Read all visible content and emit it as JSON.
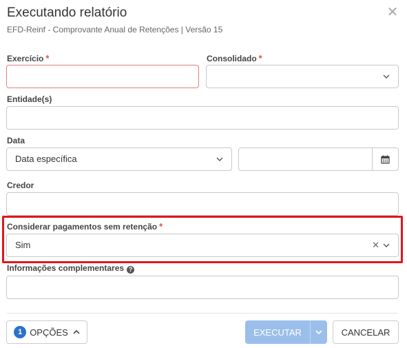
{
  "dialog": {
    "title": "Executando relatório",
    "subtitle": "EFD-Reinf - Comprovante Anual de Retenções | Versão 15",
    "close_glyph": "✕"
  },
  "fields": {
    "exercicio": {
      "label": "Exercício",
      "required_mark": "*",
      "value": ""
    },
    "consolidado": {
      "label": "Consolidado",
      "required_mark": "*",
      "value": ""
    },
    "entidades": {
      "label": "Entidade(s)",
      "value": ""
    },
    "data": {
      "label": "Data",
      "selected": "Data específica",
      "date_value": ""
    },
    "credor": {
      "label": "Credor",
      "value": ""
    },
    "considerar": {
      "label": "Considerar pagamentos sem retenção",
      "required_mark": "*",
      "selected": "Sim",
      "clear_glyph": "✕"
    },
    "informacoes": {
      "label": "Informações complementares",
      "help_glyph": "?",
      "value": ""
    }
  },
  "footer": {
    "options_count": "1",
    "options_label": "OPÇÕES",
    "execute_label": "EXECUTAR",
    "cancel_label": "CANCELAR"
  },
  "colors": {
    "highlight": "#e0161c",
    "primary_disabled": "#9bbfea",
    "badge": "#2a72c9",
    "required": "#d9534f"
  },
  "icons": [
    "close-icon",
    "chevron-down-icon",
    "calendar-icon",
    "clear-icon",
    "help-icon",
    "chevron-up-icon"
  ]
}
